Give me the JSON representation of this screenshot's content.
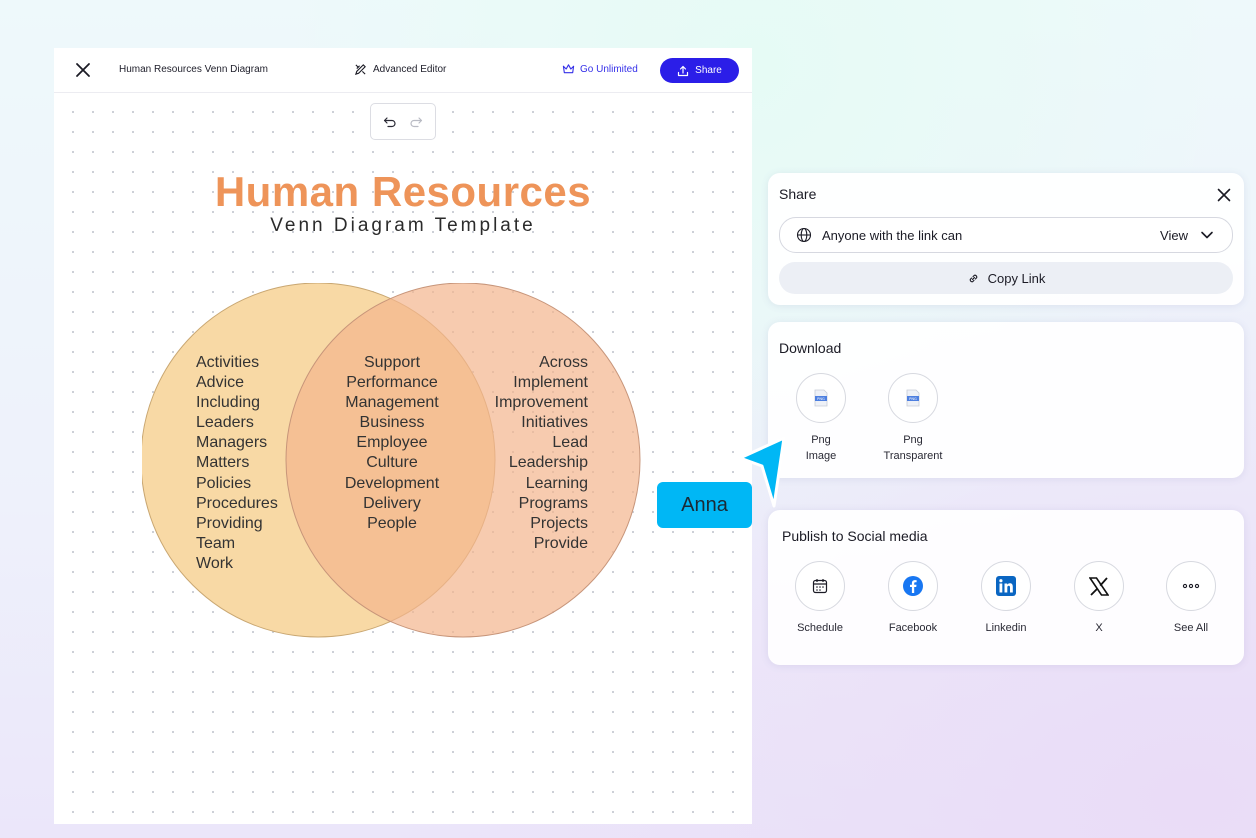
{
  "editor": {
    "doc_title": "Human Resources Venn Diagram",
    "advanced_editor": "Advanced Editor",
    "go_unlimited": "Go Unlimited",
    "share": "Share"
  },
  "diagram": {
    "title": "Human Resources",
    "subtitle": "Venn Diagram Template",
    "left": [
      "Activities",
      "Advice",
      "Including",
      "Leaders",
      "Managers",
      "Matters",
      "Policies",
      "Procedures",
      "Providing",
      "Team",
      "Work"
    ],
    "middle": [
      "Support",
      "Performance",
      "Management",
      "Business",
      "Employee",
      "Culture",
      "Development",
      "Delivery",
      "People"
    ],
    "right": [
      "Across",
      "Implement",
      "Improvement",
      "Initiatives",
      "Lead",
      "Leadership",
      "Learning",
      "Programs",
      "Projects",
      "Provide"
    ],
    "colors": {
      "left": "#f8d9a5",
      "right": "#f5c2a0",
      "overlap": "#f0ad7e",
      "title": "#ee9459"
    }
  },
  "share_panel": {
    "title": "Share",
    "access": "Anyone with the link can",
    "permission": "View",
    "copy_link": "Copy Link"
  },
  "download_panel": {
    "title": "Download",
    "options": [
      {
        "line1": "Png",
        "line2": "Image"
      },
      {
        "line1": "Png",
        "line2": "Transparent"
      }
    ]
  },
  "social_panel": {
    "title": "Publish to Social media",
    "options": [
      "Schedule",
      "Facebook",
      "Linkedin",
      "X",
      "See All"
    ]
  },
  "collaborator": {
    "name": "Anna",
    "color": "#00b7f5"
  }
}
